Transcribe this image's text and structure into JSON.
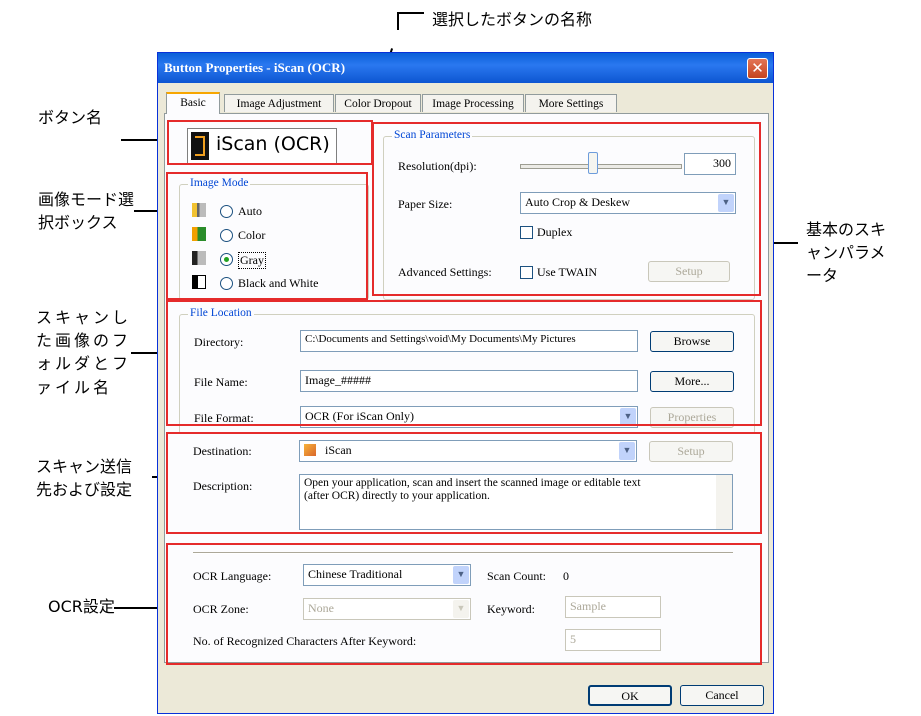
{
  "annotations": {
    "selected_button_name": "選択したボタンの名称",
    "button_name": "ボタン名",
    "image_mode_box_1": "画像モード選",
    "image_mode_box_2": "択ボックス",
    "basic_scan_params_1": "基本のスキ",
    "basic_scan_params_2": "ャンパラメ",
    "basic_scan_params_3": "ータ",
    "folder_filename_1": "スキャンし",
    "folder_filename_2": "た画像のフ",
    "folder_filename_3": "ォルダとフ",
    "folder_filename_4": "ァイル名",
    "destination_1": "スキャン送信",
    "destination_2": "先および設定",
    "ocr_settings": "OCR設定"
  },
  "dialog": {
    "title": "Button Properties - iScan (OCR)",
    "tabs": [
      "Basic",
      "Image Adjustment",
      "Color Dropout",
      "Image Processing",
      "More Settings"
    ],
    "button_name": "iScan (OCR)",
    "image_mode": {
      "title": "Image Mode",
      "options": [
        "Auto",
        "Color",
        "Gray",
        "Black and White"
      ],
      "selected": "Gray"
    },
    "scan_parameters": {
      "title": "Scan Parameters",
      "resolution_label": "Resolution(dpi):",
      "resolution_value": "300",
      "paper_size_label": "Paper Size:",
      "paper_size_value": "Auto Crop & Deskew",
      "duplex_label": "Duplex",
      "advanced_label": "Advanced Settings:",
      "use_twain_label": "Use TWAIN",
      "setup_label": "Setup"
    },
    "file_location": {
      "title": "File Location",
      "directory_label": "Directory:",
      "directory_value": "C:\\Documents and Settings\\void\\My Documents\\My Pictures",
      "browse_label": "Browse",
      "file_name_label": "File Name:",
      "file_name_value": "Image_#####",
      "more_label": "More...",
      "file_format_label": "File Format:",
      "file_format_value": "OCR (For iScan Only)",
      "properties_label": "Properties"
    },
    "destination": {
      "label": "Destination:",
      "value": "iScan",
      "setup_label": "Setup",
      "description_label": "Description:",
      "description_line1": "Open your application, scan and insert the scanned image or editable text",
      "description_line2": "(after OCR) directly to your application."
    },
    "ocr": {
      "language_label": "OCR Language:",
      "language_value": "Chinese Traditional",
      "scan_count_label": "Scan Count:",
      "scan_count_value": "0",
      "zone_label": "OCR Zone:",
      "zone_value": "None",
      "keyword_label": "Keyword:",
      "keyword_value": "Sample",
      "chars_label": "No. of Recognized Characters After Keyword:",
      "chars_value": "5"
    },
    "ok_label": "OK",
    "cancel_label": "Cancel"
  }
}
